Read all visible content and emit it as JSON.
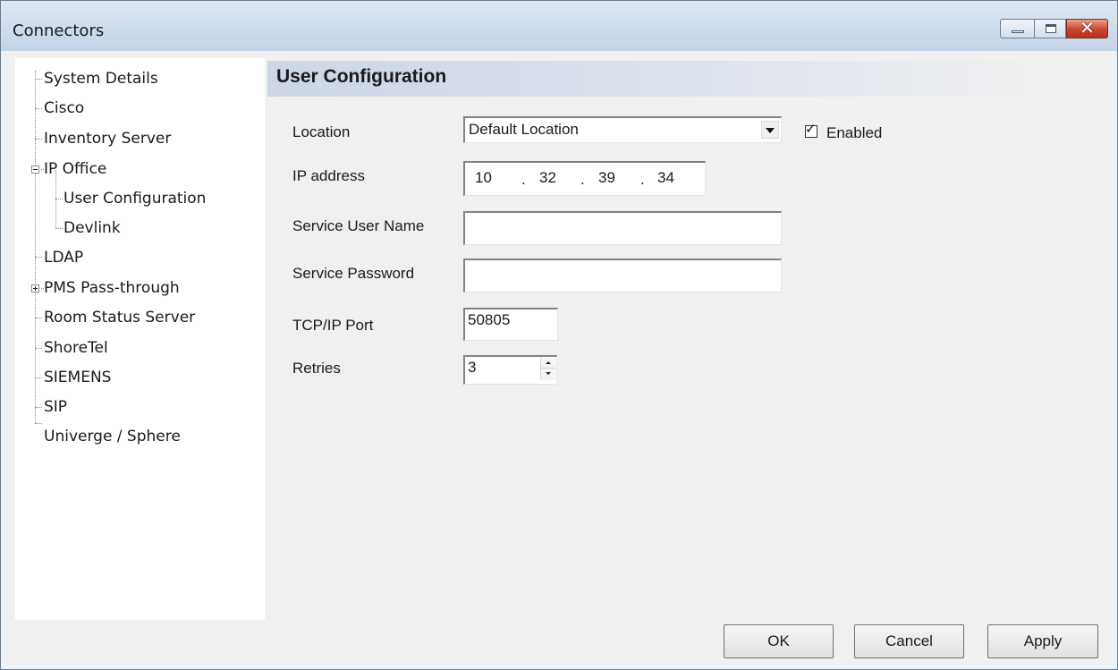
{
  "window": {
    "title": "Connectors",
    "controls": {
      "minimize": "minimize-icon",
      "maximize": "maximize-icon",
      "close": "close-icon"
    }
  },
  "tree": {
    "items": [
      {
        "label": "System Details"
      },
      {
        "label": "Cisco"
      },
      {
        "label": "Inventory Server"
      },
      {
        "label": "IP Office",
        "expanded": true
      },
      {
        "label": "User Configuration",
        "selected": true
      },
      {
        "label": "Devlink"
      },
      {
        "label": "LDAP"
      },
      {
        "label": "PMS Pass-through",
        "expanded": false
      },
      {
        "label": "Room Status Server"
      },
      {
        "label": "ShoreTel"
      },
      {
        "label": "SIEMENS"
      },
      {
        "label": "SIP"
      },
      {
        "label": "Univerge / Sphere"
      }
    ]
  },
  "panel": {
    "title": "User Configuration",
    "location": {
      "label": "Location",
      "value": "Default Location"
    },
    "enabled": {
      "label": "Enabled",
      "checked": true
    },
    "ip": {
      "label": "IP address",
      "octets": [
        "10",
        "32",
        "39",
        "34"
      ],
      "separator": "."
    },
    "service_user": {
      "label": "Service User Name",
      "value": ""
    },
    "service_password": {
      "label": "Service Password",
      "value": ""
    },
    "tcp_port": {
      "label": "TCP/IP Port",
      "value": "50805"
    },
    "retries": {
      "label": "Retries",
      "value": "3"
    }
  },
  "buttons": {
    "ok": "OK",
    "cancel": "Cancel",
    "apply": "Apply"
  },
  "colors": {
    "titlebar": "#cfdced",
    "header_gradient": "#cdd6e6",
    "close_button": "#c8452c"
  }
}
